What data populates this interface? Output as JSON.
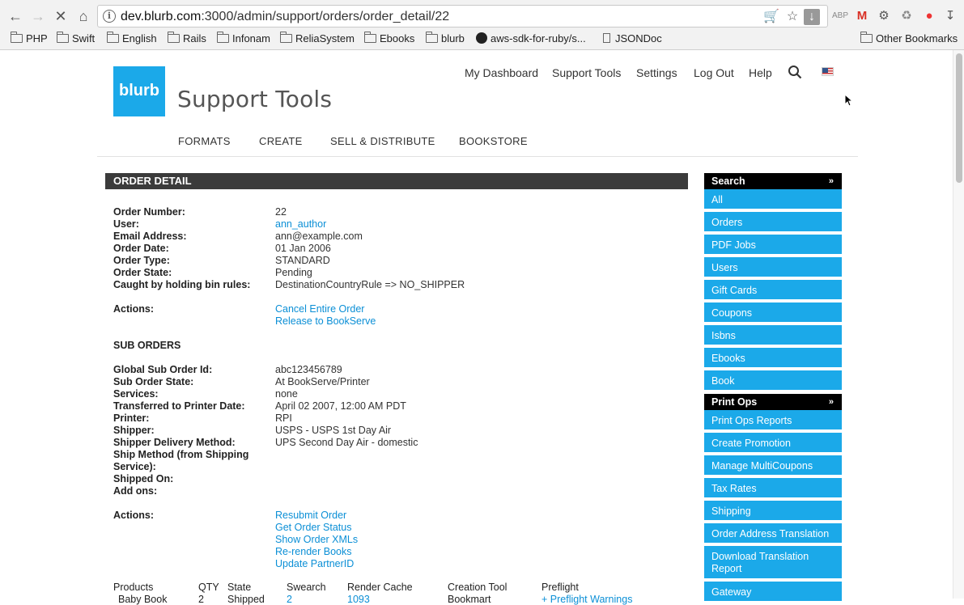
{
  "browser": {
    "url_host": "dev.blurb.com",
    "url_path": ":3000/admin/support/orders/order_detail/22",
    "bookmarks": [
      "PHP",
      "Swift",
      "English",
      "Rails",
      "Infonam",
      "ReliaSystem",
      "Ebooks",
      "blurb",
      "aws-sdk-for-ruby/s...",
      "JSONDoc"
    ],
    "other_bookmarks": "Other Bookmarks",
    "icons": [
      "back-icon",
      "forward-icon",
      "stop-icon",
      "home-icon",
      "info-icon",
      "cart-icon",
      "star-icon",
      "download-icon"
    ]
  },
  "header": {
    "logo_text": "blurb",
    "title": "Support Tools",
    "top_links": [
      "My Dashboard",
      "Support Tools",
      "Settings",
      "Log Out",
      "Help"
    ],
    "main_nav": [
      "FORMATS",
      "CREATE",
      "SELL & DISTRIBUTE",
      "BOOKSTORE"
    ]
  },
  "order": {
    "heading": "ORDER DETAIL",
    "fields": [
      {
        "label": "Order Number:",
        "value": "22"
      },
      {
        "label": "User:",
        "value": "ann_author",
        "link": true
      },
      {
        "label": "Email Address:",
        "value": "ann@example.com"
      },
      {
        "label": "Order Date:",
        "value": "01 Jan 2006"
      },
      {
        "label": "Order Type:",
        "value": "STANDARD"
      },
      {
        "label": "Order State:",
        "value": "Pending"
      },
      {
        "label": "Caught by holding bin rules:",
        "value": "DestinationCountryRule => NO_SHIPPER"
      }
    ],
    "actions_label": "Actions:",
    "actions": [
      "Cancel Entire Order",
      "Release to BookServe"
    ]
  },
  "sub_orders": {
    "heading": "SUB ORDERS",
    "fields": [
      {
        "label": "Global Sub Order Id:",
        "value": "abc123456789"
      },
      {
        "label": "Sub Order State:",
        "value": "At BookServe/Printer"
      },
      {
        "label": "Services:",
        "value": "none"
      },
      {
        "label": "Transferred to Printer Date:",
        "value": "April 02 2007, 12:00 AM PDT"
      },
      {
        "label": "Printer:",
        "value": "RPI"
      },
      {
        "label": "Shipper:",
        "value": "USPS - USPS 1st Day Air"
      },
      {
        "label": "Shipper Delivery Method:",
        "value": "UPS Second Day Air - domestic"
      },
      {
        "label": "Ship Method (from Shipping Service):",
        "value": ""
      },
      {
        "label": "Shipped On:",
        "value": ""
      },
      {
        "label": "Add ons:",
        "value": ""
      }
    ],
    "actions_label": "Actions:",
    "actions": [
      "Resubmit Order",
      "Get Order Status",
      "Show Order XMLs",
      "Re-render Books",
      "Update PartnerID"
    ],
    "product_columns": [
      "Products",
      "QTY",
      "State",
      "Swearch",
      "Render Cache",
      "Creation Tool",
      "Preflight"
    ],
    "product_row": [
      "Baby Book",
      "2",
      "Shipped",
      "2",
      "1093",
      "Bookmart",
      "Preflight Warnings"
    ]
  },
  "sidebar": {
    "search_heading": "Search",
    "search_items": [
      "All",
      "Orders",
      "PDF Jobs",
      "Users",
      "Gift Cards",
      "Coupons",
      "Isbns",
      "Ebooks",
      "Book"
    ],
    "printops_heading": "Print Ops",
    "printops_items": [
      "Print Ops Reports",
      "Create Promotion",
      "Manage MultiCoupons",
      "Tax Rates",
      "Shipping",
      "Order Address Translation",
      "Download Translation Report",
      "Gateway"
    ]
  },
  "colors": {
    "accent": "#1ba9e9",
    "link": "#0b8fd6",
    "header_bar": "#3b3b3b"
  }
}
